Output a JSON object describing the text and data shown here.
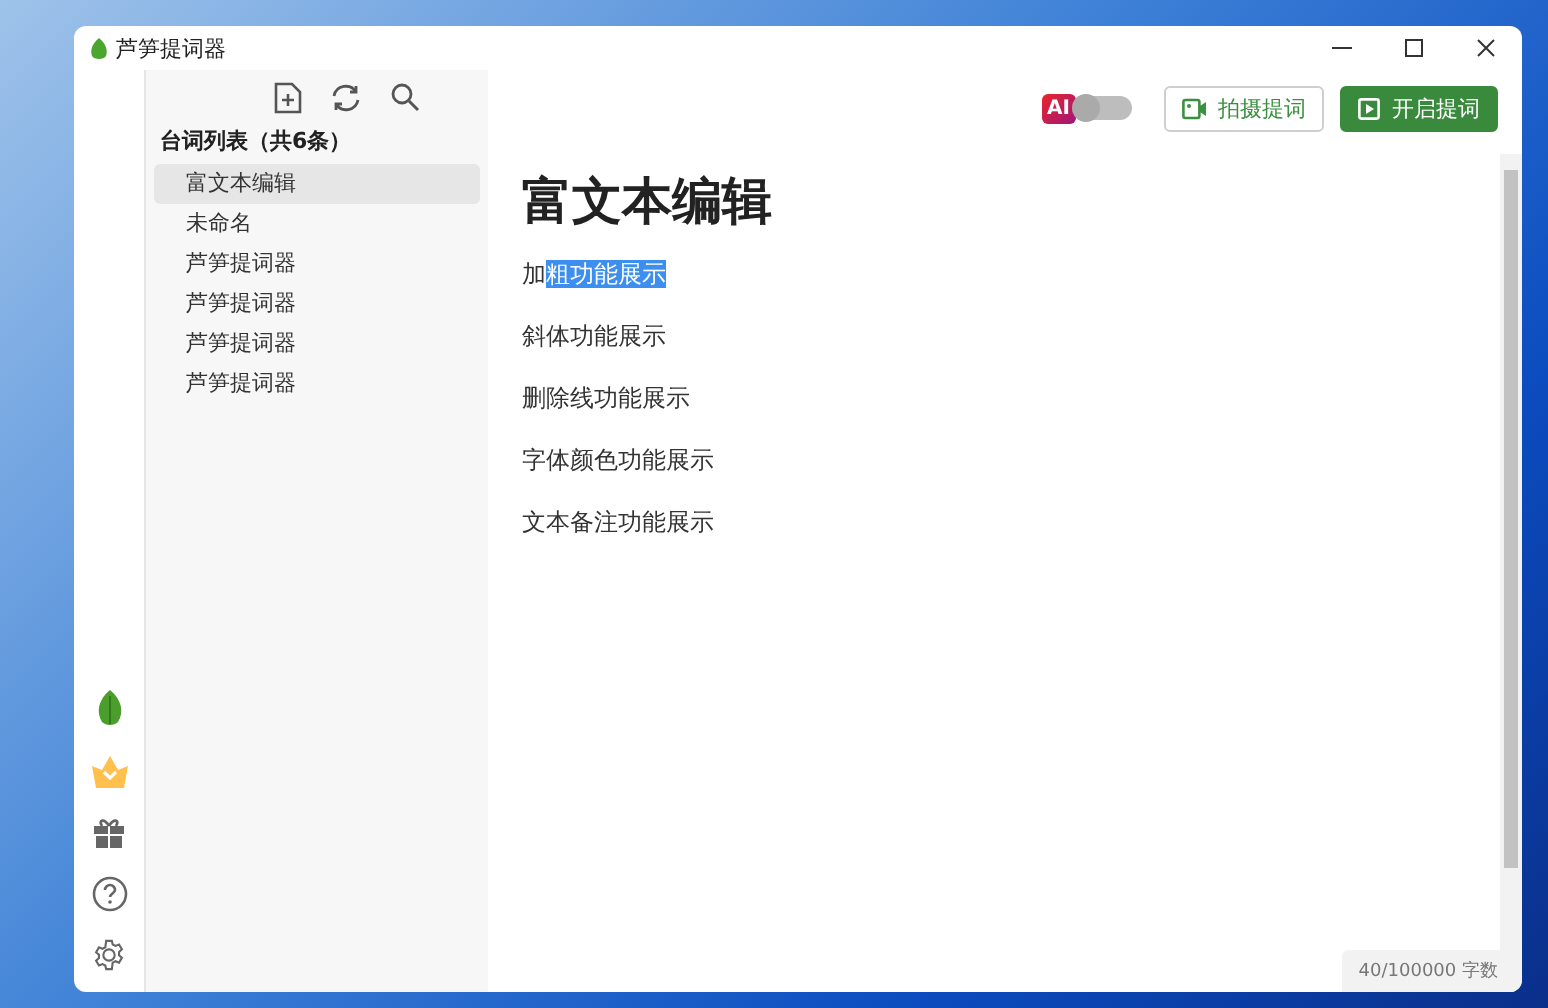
{
  "window": {
    "title": "芦笋提词器"
  },
  "sidebar": {
    "heading": "台词列表（共6条）",
    "items": [
      {
        "label": "富文本编辑",
        "selected": true
      },
      {
        "label": "未命名",
        "selected": false
      },
      {
        "label": "芦笋提词器",
        "selected": false
      },
      {
        "label": "芦笋提词器",
        "selected": false
      },
      {
        "label": "芦笋提词器",
        "selected": false
      },
      {
        "label": "芦笋提词器",
        "selected": false
      }
    ]
  },
  "toolbar": {
    "ai_badge": "AI",
    "ai_toggle": {
      "on": false
    },
    "buttons": [
      {
        "label": "拍摄提词",
        "kind": "outline"
      },
      {
        "label": "开启提词",
        "kind": "primary"
      }
    ]
  },
  "document": {
    "title": "富文本编辑",
    "paragraphs": [
      {
        "segments": [
          {
            "text": "加",
            "highlighted": false
          },
          {
            "text": "粗功能展示",
            "highlighted": true
          }
        ]
      },
      {
        "segments": [
          {
            "text": "斜体功能展示",
            "highlighted": false
          }
        ]
      },
      {
        "segments": [
          {
            "text": "删除线功能展示",
            "highlighted": false
          }
        ]
      },
      {
        "segments": [
          {
            "text": "字体颜色功能展示",
            "highlighted": false
          }
        ]
      },
      {
        "segments": [
          {
            "text": "文本备注功能展示",
            "highlighted": false
          }
        ]
      }
    ]
  },
  "status_bar": {
    "word_count": "40/100000 字数"
  }
}
